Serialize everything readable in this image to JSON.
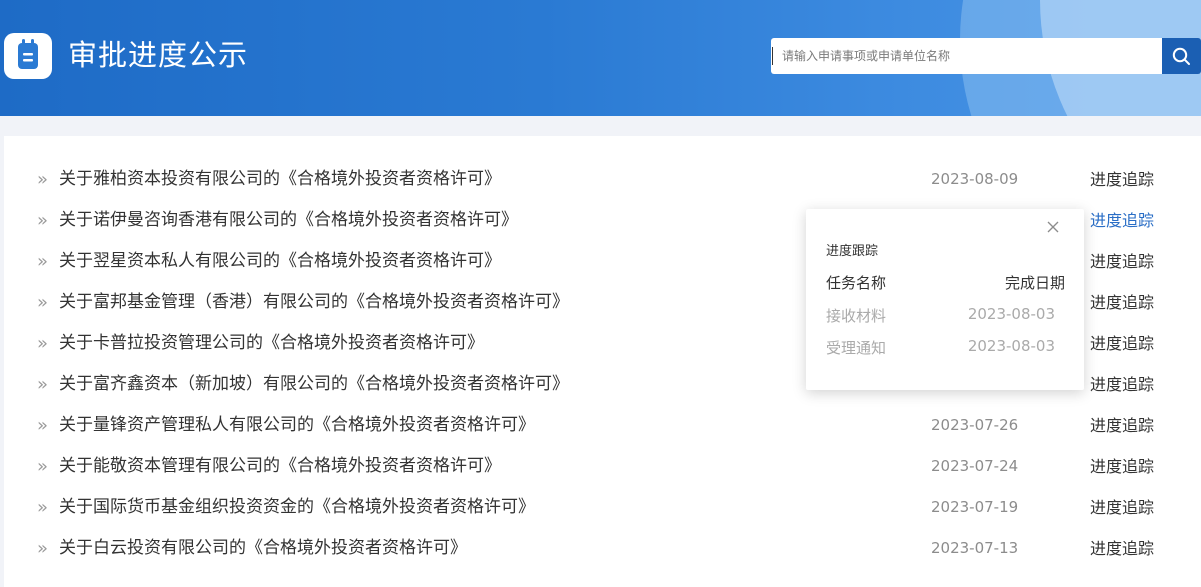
{
  "header": {
    "title": "审批进度公示",
    "search": {
      "value": "",
      "placeholder": "请输入申请事项或申请单位名称"
    },
    "colors": {
      "bar": "#2a7ad3",
      "button": "#1b5fb3"
    }
  },
  "list": {
    "arrow": "»",
    "items": [
      {
        "title": "关于雅柏资本投资有限公司的《合格境外投资者资格许可》",
        "date": "2023-08-09",
        "action": "进度追踪"
      },
      {
        "title": "关于诺伊曼咨询香港有限公司的《合格境外投资者资格许可》",
        "date": "",
        "action": "进度追踪"
      },
      {
        "title": "关于翌星资本私人有限公司的《合格境外投资者资格许可》",
        "date": "",
        "action": "进度追踪"
      },
      {
        "title": "关于富邦基金管理（香港）有限公司的《合格境外投资者资格许可》",
        "date": "",
        "action": "进度追踪"
      },
      {
        "title": "关于卡普拉投资管理公司的《合格境外投资者资格许可》",
        "date": "",
        "action": "进度追踪"
      },
      {
        "title": "关于富齐鑫资本（新加坡）有限公司的《合格境外投资者资格许可》",
        "date": "",
        "action": "进度追踪"
      },
      {
        "title": "关于量锋资产管理私人有限公司的《合格境外投资者资格许可》",
        "date": "2023-07-26",
        "action": "进度追踪"
      },
      {
        "title": "关于能敬资本管理有限公司的《合格境外投资者资格许可》",
        "date": "2023-07-24",
        "action": "进度追踪"
      },
      {
        "title": "关于国际货币基金组织投资资金的《合格境外投资者资格许可》",
        "date": "2023-07-19",
        "action": "进度追踪"
      },
      {
        "title": "关于白云投资有限公司的《合格境外投资者资格许可》",
        "date": "2023-07-13",
        "action": "进度追踪"
      }
    ]
  },
  "popover": {
    "title": "进度跟踪",
    "col_task": "任务名称",
    "col_date": "完成日期",
    "steps": [
      {
        "name": "接收材料",
        "date": "2023-08-03"
      },
      {
        "name": "受理通知",
        "date": "2023-08-03"
      }
    ]
  }
}
